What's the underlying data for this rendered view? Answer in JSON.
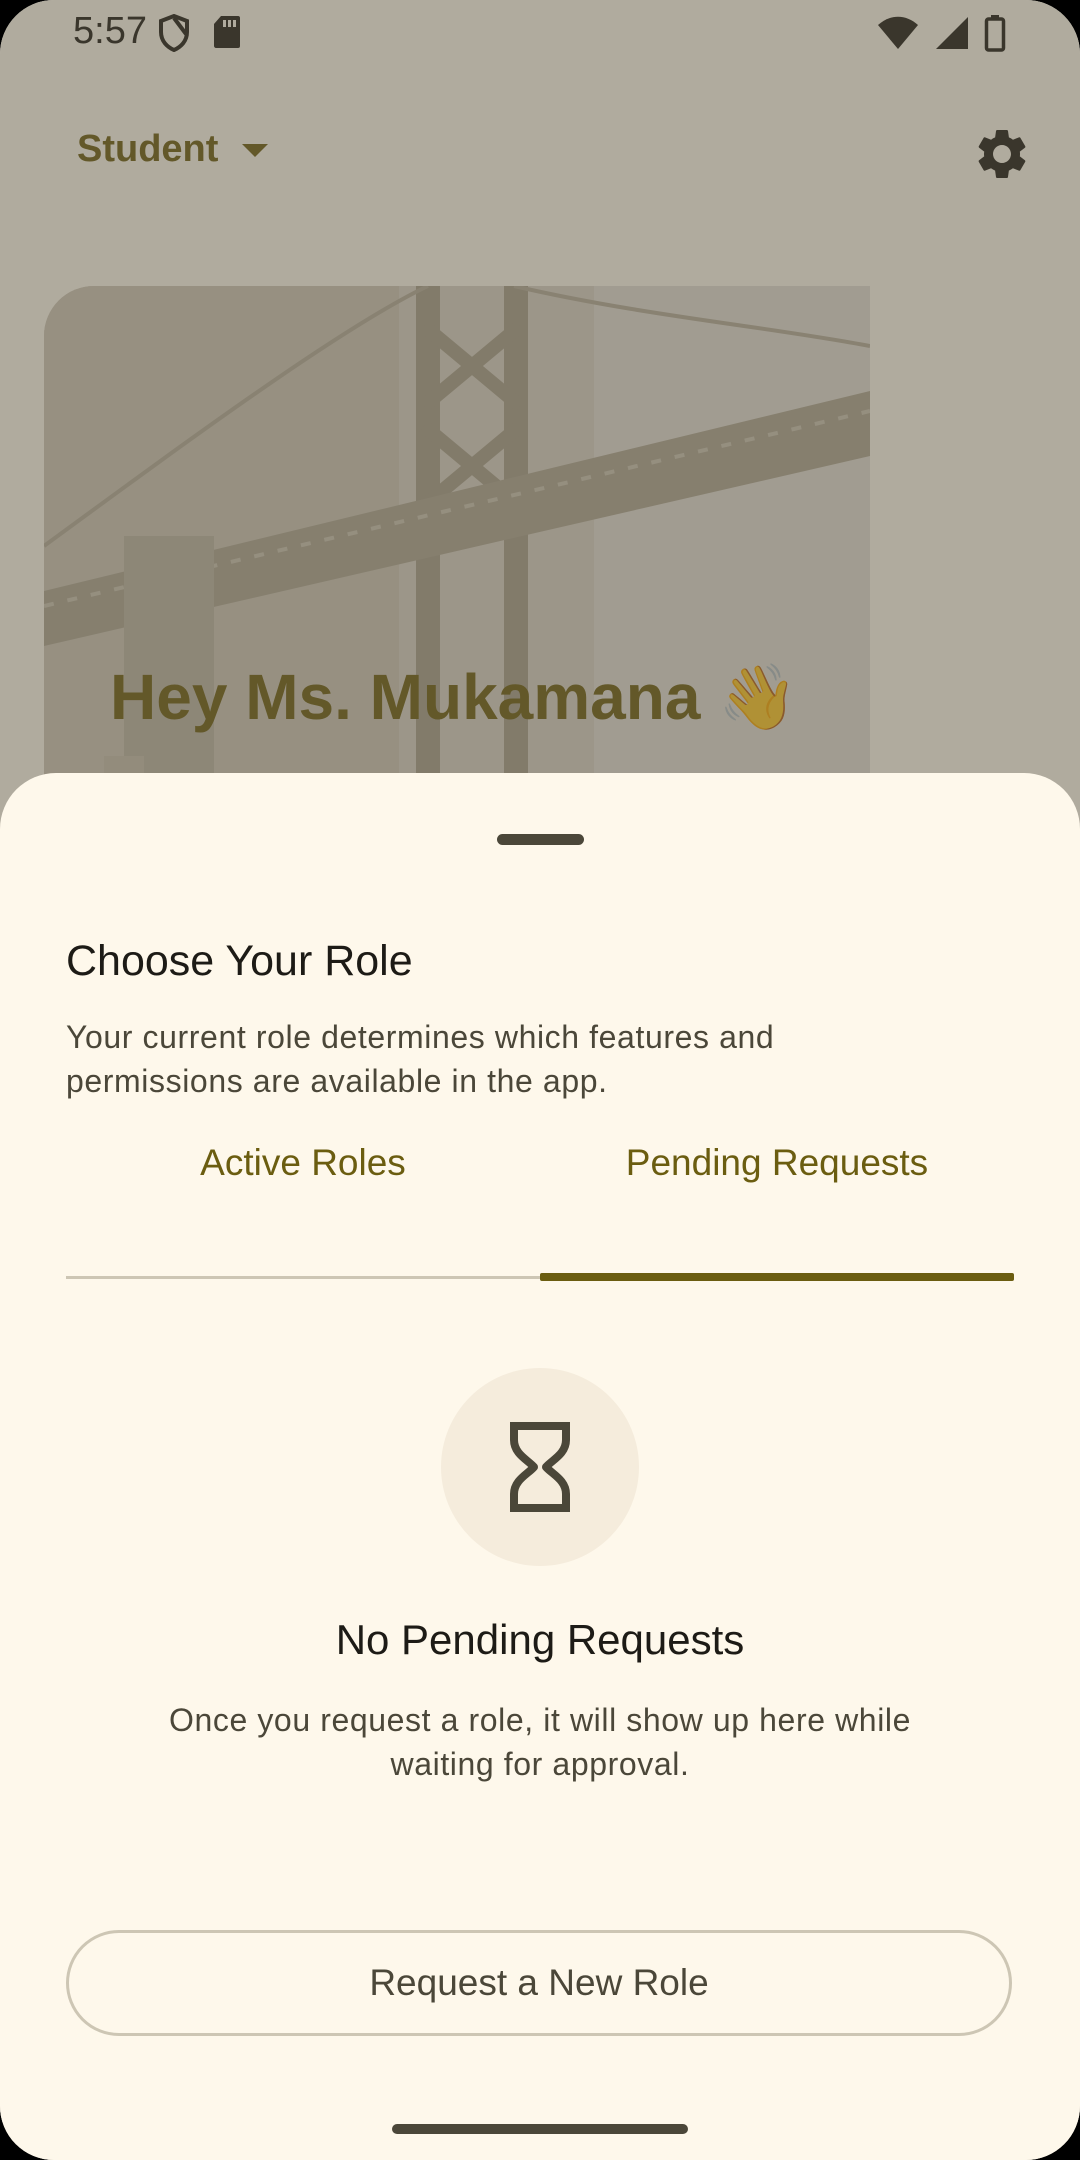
{
  "status_bar": {
    "time": "5:57",
    "left_icons": [
      "shield-icon",
      "sd-card-icon"
    ],
    "right_icons": [
      "wifi-icon",
      "signal-icon",
      "battery-icon"
    ]
  },
  "header": {
    "role_selector_label": "Student",
    "role_selector_icon": "dropdown-arrow-icon",
    "settings_icon": "gear-icon"
  },
  "hero": {
    "greeting": "Hey Ms. Mukamana 👋"
  },
  "sheet": {
    "title": "Choose Your Role",
    "description": "Your current role determines which features and permissions are available in the app.",
    "tabs": [
      {
        "label": "Active Roles",
        "selected": false
      },
      {
        "label": "Pending Requests",
        "selected": true
      }
    ],
    "empty_state": {
      "icon": "hourglass-icon",
      "title": "No Pending Requests",
      "description": "Once you request a role, it will show up here while waiting for approval."
    },
    "primary_button": "Request a New Role"
  },
  "colors": {
    "accent": "#6b5d10",
    "sheet_background": "#fef8eb",
    "on_surface": "#1d1b16",
    "on_surface_variant": "#4b4739",
    "outline": "#cdc6b4"
  }
}
